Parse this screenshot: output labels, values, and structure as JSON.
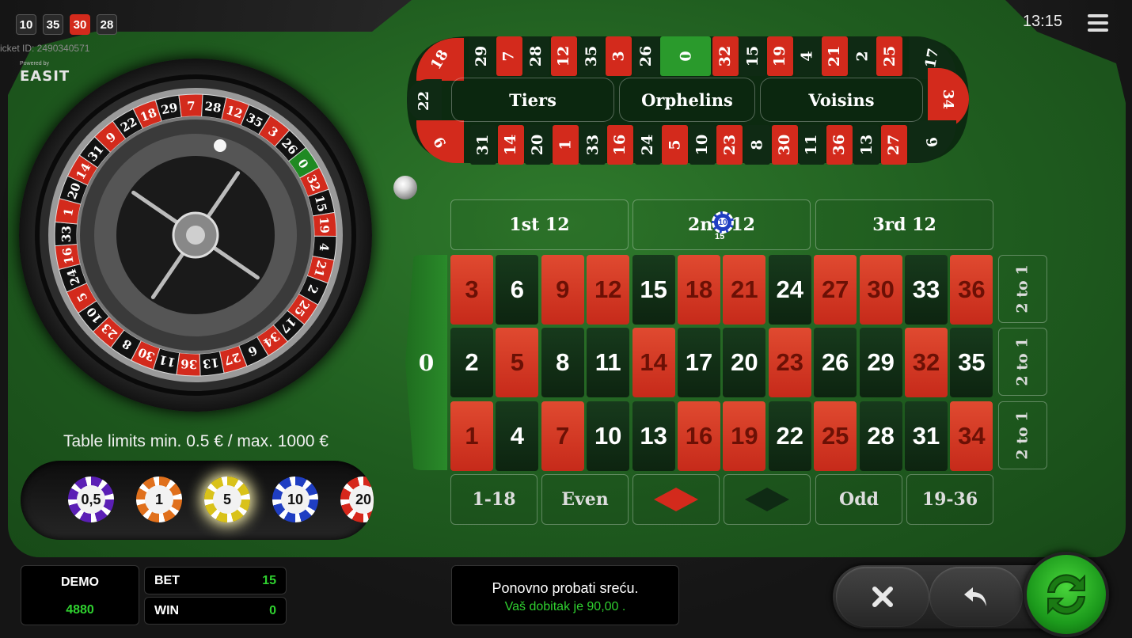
{
  "history": [
    {
      "value": "10",
      "color": "black"
    },
    {
      "value": "35",
      "color": "black"
    },
    {
      "value": "30",
      "color": "red"
    },
    {
      "value": "28",
      "color": "black"
    }
  ],
  "ticket": "icket ID: 2490340571",
  "powered_by": "Powered by",
  "logo": "EASIT",
  "clock": "13:15",
  "wheel_numbers": [
    "0",
    "32",
    "15",
    "19",
    "4",
    "21",
    "2",
    "25",
    "17",
    "34",
    "6",
    "27",
    "13",
    "36",
    "11",
    "30",
    "8",
    "23",
    "10",
    "5",
    "24",
    "16",
    "33",
    "1",
    "20",
    "14",
    "31",
    "9",
    "22",
    "18",
    "29",
    "7",
    "28",
    "12",
    "35",
    "3",
    "26"
  ],
  "racetrack": {
    "top": [
      {
        "n": "29",
        "c": "black"
      },
      {
        "n": "7",
        "c": "red"
      },
      {
        "n": "28",
        "c": "black"
      },
      {
        "n": "12",
        "c": "red"
      },
      {
        "n": "35",
        "c": "black"
      },
      {
        "n": "3",
        "c": "red"
      },
      {
        "n": "26",
        "c": "black"
      },
      {
        "n": "0",
        "c": "green"
      },
      {
        "n": "32",
        "c": "red"
      },
      {
        "n": "15",
        "c": "black"
      },
      {
        "n": "19",
        "c": "red"
      },
      {
        "n": "4",
        "c": "black"
      },
      {
        "n": "21",
        "c": "red"
      },
      {
        "n": "2",
        "c": "black"
      },
      {
        "n": "25",
        "c": "red"
      }
    ],
    "bottom": [
      {
        "n": "31",
        "c": "black"
      },
      {
        "n": "14",
        "c": "red"
      },
      {
        "n": "20",
        "c": "black"
      },
      {
        "n": "1",
        "c": "red"
      },
      {
        "n": "33",
        "c": "black"
      },
      {
        "n": "16",
        "c": "red"
      },
      {
        "n": "24",
        "c": "black"
      },
      {
        "n": "5",
        "c": "red"
      },
      {
        "n": "10",
        "c": "black"
      },
      {
        "n": "23",
        "c": "red"
      },
      {
        "n": "8",
        "c": "black"
      },
      {
        "n": "30",
        "c": "red"
      },
      {
        "n": "11",
        "c": "black"
      },
      {
        "n": "36",
        "c": "red"
      },
      {
        "n": "13",
        "c": "black"
      },
      {
        "n": "27",
        "c": "red"
      }
    ],
    "left_end": [
      "18",
      "22",
      "9"
    ],
    "right_end": [
      "17",
      "34",
      "6"
    ],
    "sections": [
      "Tiers",
      "Orphelins",
      "Voisins"
    ]
  },
  "dozens": [
    "1st  12",
    "2nd  12",
    "3rd  12"
  ],
  "zero": "0",
  "grid": {
    "top_row": [
      {
        "n": "3",
        "c": "red"
      },
      {
        "n": "6",
        "c": "black"
      },
      {
        "n": "9",
        "c": "red"
      },
      {
        "n": "12",
        "c": "red"
      },
      {
        "n": "15",
        "c": "black"
      },
      {
        "n": "18",
        "c": "red"
      },
      {
        "n": "21",
        "c": "red"
      },
      {
        "n": "24",
        "c": "black"
      },
      {
        "n": "27",
        "c": "red"
      },
      {
        "n": "30",
        "c": "red"
      },
      {
        "n": "33",
        "c": "black"
      },
      {
        "n": "36",
        "c": "red"
      }
    ],
    "middle_row": [
      {
        "n": "2",
        "c": "black"
      },
      {
        "n": "5",
        "c": "red"
      },
      {
        "n": "8",
        "c": "black"
      },
      {
        "n": "11",
        "c": "black"
      },
      {
        "n": "14",
        "c": "red"
      },
      {
        "n": "17",
        "c": "black"
      },
      {
        "n": "20",
        "c": "black"
      },
      {
        "n": "23",
        "c": "red"
      },
      {
        "n": "26",
        "c": "black"
      },
      {
        "n": "29",
        "c": "black"
      },
      {
        "n": "32",
        "c": "red"
      },
      {
        "n": "35",
        "c": "black"
      }
    ],
    "bottom_row": [
      {
        "n": "1",
        "c": "red"
      },
      {
        "n": "4",
        "c": "black"
      },
      {
        "n": "7",
        "c": "red"
      },
      {
        "n": "10",
        "c": "black"
      },
      {
        "n": "13",
        "c": "black"
      },
      {
        "n": "16",
        "c": "red"
      },
      {
        "n": "19",
        "c": "red"
      },
      {
        "n": "22",
        "c": "black"
      },
      {
        "n": "25",
        "c": "red"
      },
      {
        "n": "28",
        "c": "black"
      },
      {
        "n": "31",
        "c": "black"
      },
      {
        "n": "34",
        "c": "red"
      }
    ]
  },
  "column_bets": [
    "2 to 1",
    "2 to 1",
    "2 to 1"
  ],
  "outside_bets": {
    "low": "1-18",
    "even": "Even",
    "odd": "Odd",
    "high": "19-36"
  },
  "placed_chip": {
    "value": "10",
    "total": "15"
  },
  "limits": "Table limits min. 0.5 € / max. 1000 €",
  "chips": [
    {
      "label": "0,5",
      "color": "#5b1fb5"
    },
    {
      "label": "1",
      "color": "#e0701c"
    },
    {
      "label": "5",
      "color": "#d9c21a",
      "selected": true
    },
    {
      "label": "10",
      "color": "#1f3ec2"
    },
    {
      "label": "20",
      "color": "#d6281c"
    }
  ],
  "account": {
    "demo_label": "DEMO",
    "demo_value": "4880",
    "bet_label": "BET",
    "bet_value": "15",
    "win_label": "WIN",
    "win_value": "0"
  },
  "message": {
    "line1": "Ponovno probati sreću.",
    "line2": "Vaš dobitak je 90,00 ."
  },
  "colors": {
    "red": "#d32a1c",
    "black": "#0f2a14",
    "green": "#2a9a2c",
    "felt": "#2a6e26",
    "accent_green": "#2fd12f"
  },
  "icons": {
    "menu": "hamburger-menu-icon",
    "clear": "close-icon",
    "undo": "undo-icon",
    "spin": "refresh-icon"
  }
}
